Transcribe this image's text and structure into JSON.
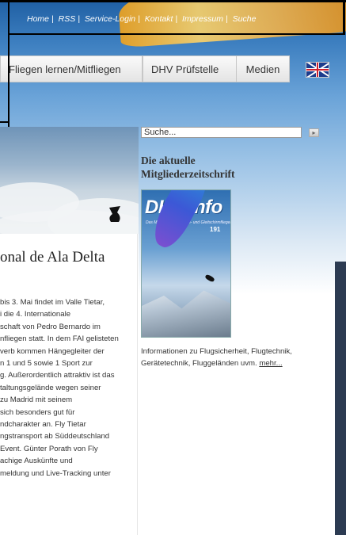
{
  "top_links": [
    "Home",
    "RSS",
    "Service-Login",
    "Kontakt",
    "Impressum",
    "Suche"
  ],
  "nav": {
    "items": [
      "Fliegen lernen/Mitfliegen",
      "DHV Prüfstelle",
      "Medien"
    ],
    "language_flag": "uk-flag-icon"
  },
  "search": {
    "placeholder": "Suche...",
    "value": "Suche..."
  },
  "sidebar": {
    "heading_line1": "Die aktuelle",
    "heading_line2": "Mitgliederzeitschrift",
    "magazine": {
      "masthead": "DHV-info",
      "subtitle": "Das Magazin für Drachen- und Gleitschirmflieger",
      "issue": "191"
    },
    "description": "Informationen zu Flugsicherheit, Flugtechnik, Gerätetechnik, Fluggeländen uvm.",
    "more_link": "mehr..."
  },
  "article": {
    "title": "onal de Ala Delta",
    "body_lines": [
      "bis 3. Mai findet im Valle Tietar,",
      "i die 4. Internationale",
      "schaft von Pedro Bernardo im",
      "nfliegen statt. In dem FAI gelisteten",
      "verb kommen Hängegleiter der",
      "n 1 und 5 sowie 1 Sport zur",
      "g. Außerordentlich attraktiv ist das",
      "taltungsgelände wegen seiner",
      "zu Madrid mit seinem",
      "sich besonders gut für",
      "ndcharakter an. Fly Tietar",
      "ngstransport ab Süddeutschland",
      "Event. Günter Porath von Fly",
      "achige Auskünfte und",
      "meldung und Live-Tracking unter"
    ]
  },
  "colors": {
    "sky_top": "#1f5fa3",
    "nav_text": "#333333",
    "link_text": "#ffffff"
  }
}
